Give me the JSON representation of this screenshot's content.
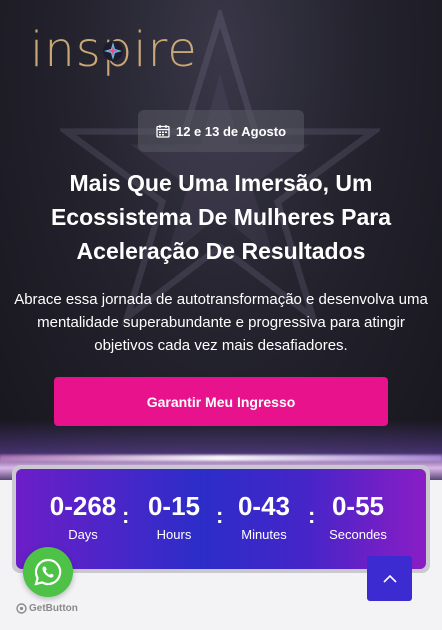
{
  "logo": {
    "text": "inspire"
  },
  "event": {
    "date": "12 e 13 de Agosto"
  },
  "hero": {
    "headline": "Mais Que Uma Imersão, Um Ecossistema De Mulheres Para Aceleração De Resultados",
    "subtext": "Abrace essa jornada de autotransformação e desenvolva uma mentalidade superabundante e progressiva para atingir objetivos cada vez mais desafiadores.",
    "cta_label": "Garantir Meu Ingresso"
  },
  "countdown": {
    "days": "0-268",
    "days_label": "Days",
    "hours": "0-15",
    "hours_label": "Hours",
    "minutes": "0-43",
    "minutes_label": "Minutes",
    "seconds": "0-55",
    "seconds_label": "Secondes",
    "separator": ":"
  },
  "widgets": {
    "getbutton_label": "GetButton"
  },
  "colors": {
    "accent": "#e8128c",
    "logo_gold": "#c8a877",
    "whatsapp": "#4dc247",
    "scroll_button": "#3b2bd0"
  },
  "icons": [
    "calendar-icon",
    "whatsapp-icon",
    "chevron-up-icon",
    "star-logo-icon"
  ]
}
